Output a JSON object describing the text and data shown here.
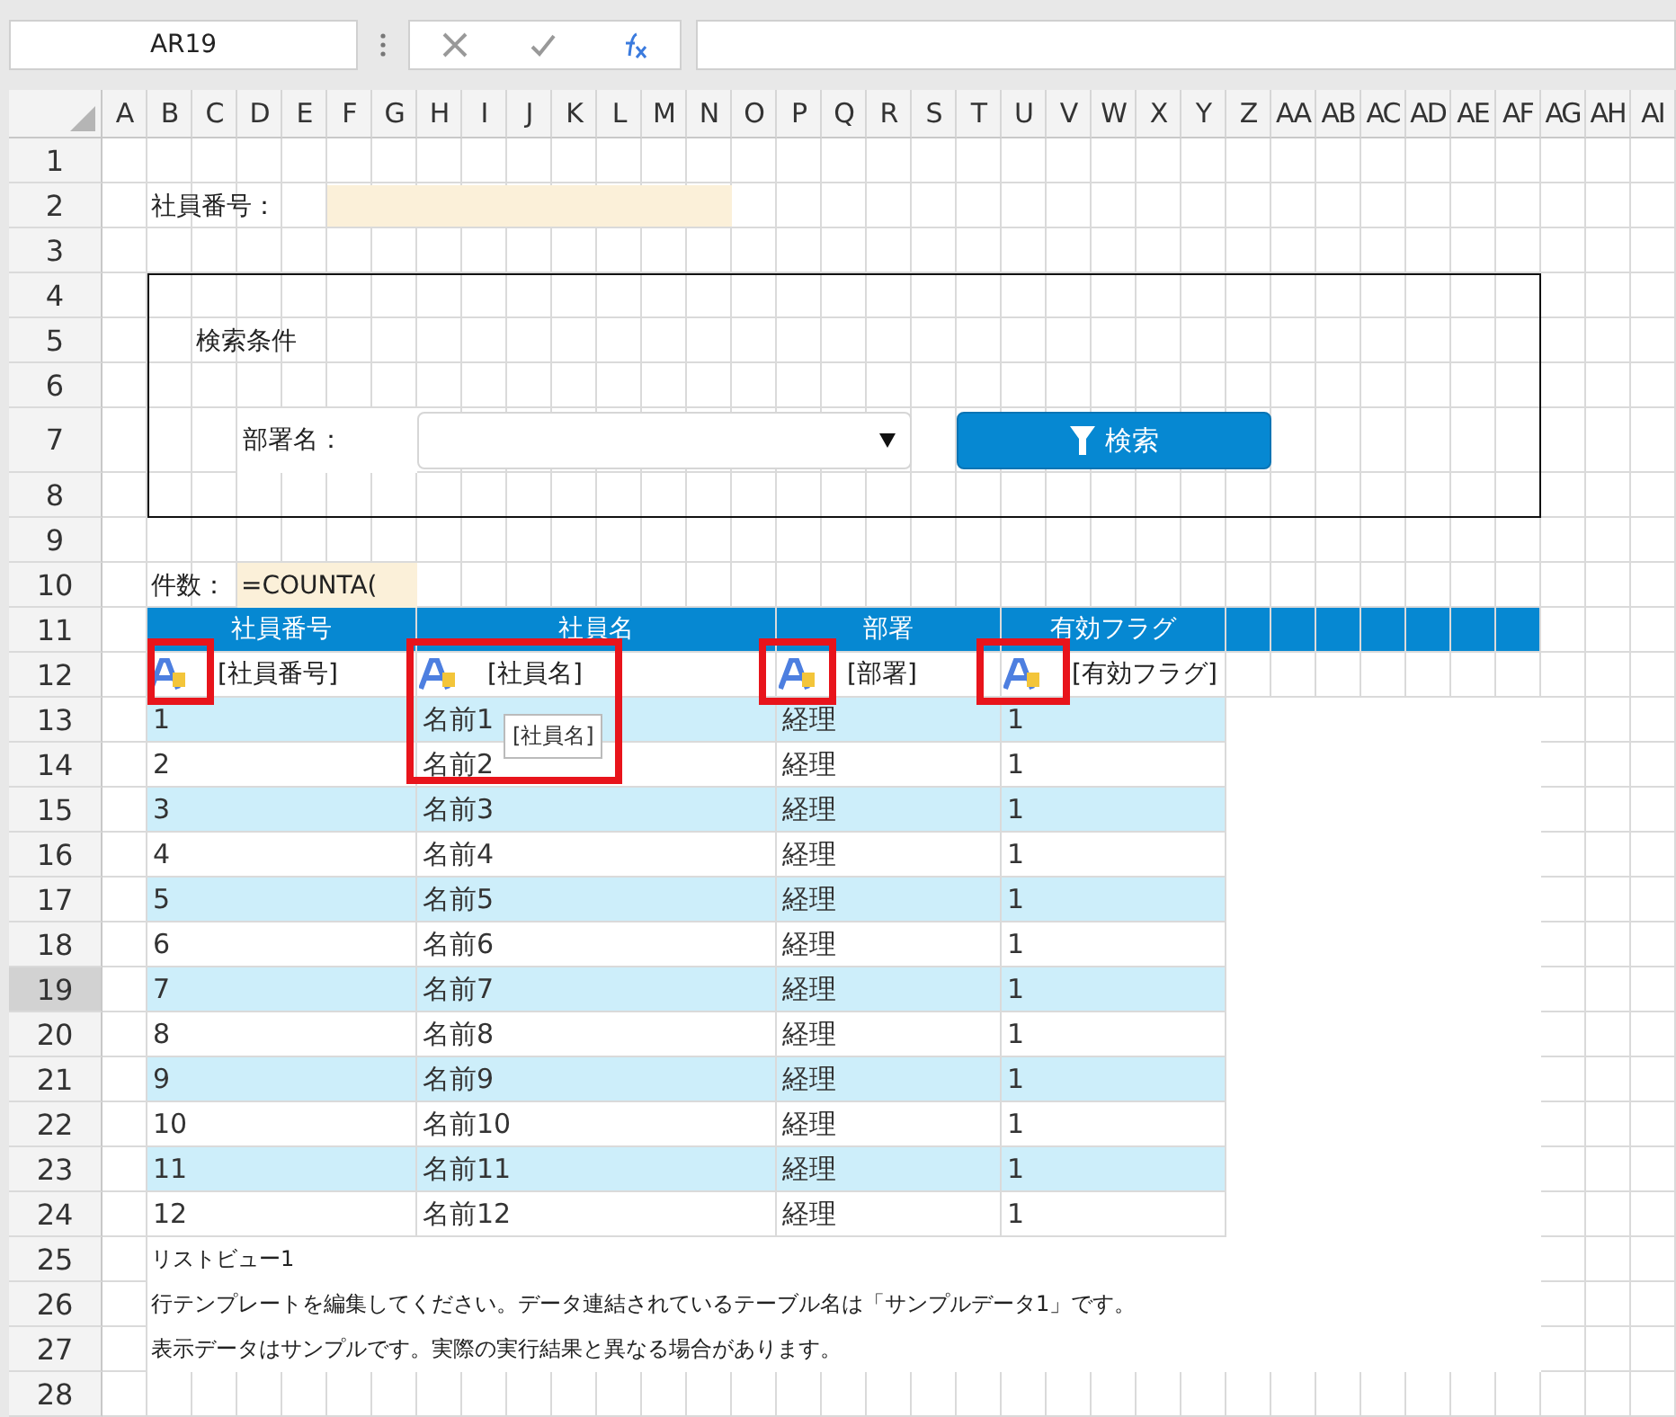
{
  "name_box": "AR19",
  "column_headers": [
    "A",
    "B",
    "C",
    "D",
    "E",
    "F",
    "G",
    "H",
    "I",
    "J",
    "K",
    "L",
    "M",
    "N",
    "O",
    "P",
    "Q",
    "R",
    "S",
    "T",
    "U",
    "V",
    "W",
    "X",
    "Y",
    "Z",
    "AA",
    "AB",
    "AC",
    "AD",
    "AE",
    "AF",
    "AG",
    "AH",
    "AI"
  ],
  "row_headers": [
    {
      "label": "1",
      "selected": false
    },
    {
      "label": "2",
      "selected": false
    },
    {
      "label": "3",
      "selected": false
    },
    {
      "label": "4",
      "selected": false
    },
    {
      "label": "5",
      "selected": false
    },
    {
      "label": "6",
      "selected": false
    },
    {
      "label": "7",
      "selected": false
    },
    {
      "label": "8",
      "selected": false
    },
    {
      "label": "9",
      "selected": false
    },
    {
      "label": "10",
      "selected": false
    },
    {
      "label": "11",
      "selected": false
    },
    {
      "label": "12",
      "selected": false
    },
    {
      "label": "13",
      "selected": false
    },
    {
      "label": "14",
      "selected": false
    },
    {
      "label": "15",
      "selected": false
    },
    {
      "label": "16",
      "selected": false
    },
    {
      "label": "17",
      "selected": false
    },
    {
      "label": "18",
      "selected": false
    },
    {
      "label": "19",
      "selected": true
    },
    {
      "label": "20",
      "selected": false
    },
    {
      "label": "21",
      "selected": false
    },
    {
      "label": "22",
      "selected": false
    },
    {
      "label": "23",
      "selected": false
    },
    {
      "label": "24",
      "selected": false
    },
    {
      "label": "25",
      "selected": false
    },
    {
      "label": "26",
      "selected": false
    },
    {
      "label": "27",
      "selected": false
    },
    {
      "label": "28",
      "selected": false
    }
  ],
  "employee_id": {
    "label": "社員番号："
  },
  "search_panel": {
    "title": "検索条件",
    "department_label": "部署名：",
    "search_button": "検索"
  },
  "count": {
    "label": "件数：",
    "formula": "=COUNTA("
  },
  "list_view": {
    "columns": [
      "社員番号",
      "社員名",
      "部署",
      "有効フラグ"
    ],
    "template": [
      "[社員番号]",
      "[社員名]",
      "[部署]",
      "[有効フラグ]"
    ],
    "rows": [
      [
        "1",
        "名前1",
        "経理",
        "1"
      ],
      [
        "2",
        "名前2",
        "経理",
        "1"
      ],
      [
        "3",
        "名前3",
        "経理",
        "1"
      ],
      [
        "4",
        "名前4",
        "経理",
        "1"
      ],
      [
        "5",
        "名前5",
        "経理",
        "1"
      ],
      [
        "6",
        "名前6",
        "経理",
        "1"
      ],
      [
        "7",
        "名前7",
        "経理",
        "1"
      ],
      [
        "8",
        "名前8",
        "経理",
        "1"
      ],
      [
        "9",
        "名前9",
        "経理",
        "1"
      ],
      [
        "10",
        "名前10",
        "経理",
        "1"
      ],
      [
        "11",
        "名前11",
        "経理",
        "1"
      ],
      [
        "12",
        "名前12",
        "経理",
        "1"
      ]
    ],
    "notes": [
      "リストビュー1",
      "行テンプレートを編集してください。データ連結されているテーブル名は「サンプルデータ1」です。",
      "表示データはサンプルです。実際の実行結果と異なる場合があります。"
    ]
  },
  "tooltip": "[社員名]"
}
